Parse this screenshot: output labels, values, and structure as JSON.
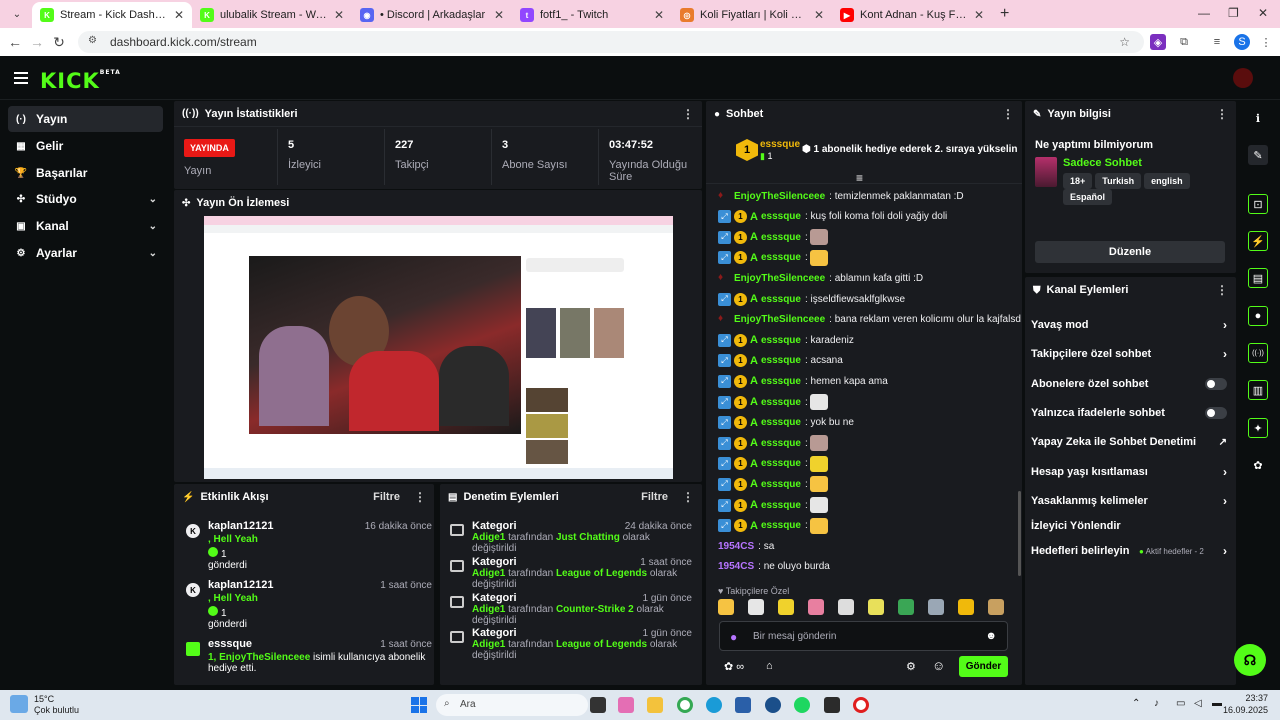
{
  "browser": {
    "tabs": [
      {
        "title": "Stream - Kick Dashboard",
        "fav": "K",
        "fav_color": "#53fc18",
        "active": true
      },
      {
        "title": "ulubalik Stream - Watch Live on",
        "fav": "K",
        "fav_color": "#53fc18"
      },
      {
        "title": "• Discord | Arkadaşlar",
        "fav": "◉",
        "fav_color": "#5865f2"
      },
      {
        "title": "fotf1_ - Twitch",
        "fav": "t",
        "fav_color": "#9146ff"
      },
      {
        "title": "Koli Fiyatları | Koli Karton ve Ambalaj",
        "fav": "◎",
        "fav_color": "#e97b2c"
      },
      {
        "title": "Kont Adnan - Kuş Foli. Official",
        "fav": "▶",
        "fav_color": "#ff0000"
      }
    ],
    "url": "dashboard.kick.com/stream"
  },
  "sidebar": {
    "items": [
      {
        "label": "Yayın",
        "icon": "broadcast-icon",
        "glyph": "(·)"
      },
      {
        "label": "Gelir",
        "icon": "revenue-icon",
        "glyph": "▦"
      },
      {
        "label": "Başarılar",
        "icon": "trophy-icon",
        "glyph": "🏆"
      },
      {
        "label": "Stüdyo",
        "icon": "studio-icon",
        "glyph": "✣"
      },
      {
        "label": "Kanal",
        "icon": "channel-icon",
        "glyph": "▣"
      },
      {
        "label": "Ayarlar",
        "icon": "settings-icon",
        "glyph": "⚙"
      }
    ]
  },
  "stats": {
    "title": "Yayın İstatistikleri",
    "live_badge": "YAYINDA",
    "live_label": "Yayın",
    "viewers": "5",
    "viewers_label": "İzleyici",
    "followers": "227",
    "followers_label": "Takipçi",
    "subs": "3",
    "subs_label": "Abone Sayısı",
    "uptime": "03:47:52",
    "uptime_label": "Yayında Olduğu Süre"
  },
  "preview": {
    "title": "Yayın Ön İzlemesi"
  },
  "activity": {
    "title": "Etkinlik Akışı",
    "filter": "Filtre",
    "items": [
      {
        "name": "kaplan12121",
        "time": "16 dakika önce",
        "msg": ", Hell Yeah",
        "count": "1",
        "sent": "gönderdi"
      },
      {
        "name": "kaplan12121",
        "time": "1 saat önce",
        "msg": ", Hell Yeah",
        "count": "1",
        "sent": "gönderdi"
      },
      {
        "name": "esssque",
        "time": "1 saat önce",
        "msg": "1, EnjoyTheSilenceee",
        "tail": " isimli kullanıcıya abonelik hediye etti."
      }
    ]
  },
  "moderation": {
    "title": "Denetim Eylemleri",
    "filter": "Filtre",
    "items": [
      {
        "t": "Kategori",
        "time": "24 dakika önce",
        "user": "Adige1",
        "mid": " tarafından ",
        "cat": "Just Chatting",
        "tail": " olarak değiştirildi"
      },
      {
        "t": "Kategori",
        "time": "1 saat önce",
        "user": "Adige1",
        "mid": " tarafından ",
        "cat": "League of Legends",
        "tail": " olarak değiştirildi"
      },
      {
        "t": "Kategori",
        "time": "1 gün önce",
        "user": "Adige1",
        "mid": " tarafından ",
        "cat": "Counter-Strike 2",
        "tail": " olarak değiştirildi"
      },
      {
        "t": "Kategori",
        "time": "1 gün önce",
        "user": "Adige1",
        "mid": " tarafından ",
        "cat": "League of Legends",
        "tail": " olarak değiştirildi"
      }
    ]
  },
  "chat": {
    "title": "Sohbet",
    "pinned_user": "esssque",
    "pinned_rank": "1",
    "pinned_count": "1",
    "pinned_text": "1 abonelik hediye ederek 2. sıraya yükselin",
    "messages": [
      {
        "user": "EnjoyTheSilenceee",
        "color": "#53fc18",
        "text": ": temizlenmek paklanmatan :D",
        "badges": "dot"
      },
      {
        "user": "esssque",
        "color": "#53fc18",
        "text": ": kuş foli koma foli doli yağiy doli",
        "badges": "full"
      },
      {
        "user": "esssque",
        "color": "#53fc18",
        "text": ":",
        "badges": "full",
        "emote": "#b89a94"
      },
      {
        "user": "esssque",
        "color": "#53fc18",
        "text": ":",
        "badges": "full",
        "emote": "#f6c342"
      },
      {
        "user": "EnjoyTheSilenceee",
        "color": "#53fc18",
        "text": ": ablamın kafa gitti :D",
        "badges": "dot"
      },
      {
        "user": "esssque",
        "color": "#53fc18",
        "text": ": işseldfiewsaklfglkwse",
        "badges": "full"
      },
      {
        "user": "EnjoyTheSilenceee",
        "color": "#53fc18",
        "text": ": bana reklam veren kolicımı olur la kajfalsd",
        "badges": "dot"
      },
      {
        "user": "esssque",
        "color": "#53fc18",
        "text": ": karadeniz",
        "badges": "full"
      },
      {
        "user": "esssque",
        "color": "#53fc18",
        "text": ": acsana",
        "badges": "full"
      },
      {
        "user": "esssque",
        "color": "#53fc18",
        "text": ": hemen kapa ama",
        "badges": "full"
      },
      {
        "user": "esssque",
        "color": "#53fc18",
        "text": ":",
        "badges": "full",
        "emote": "#e6e6e6"
      },
      {
        "user": "esssque",
        "color": "#53fc18",
        "text": ": yok bu ne",
        "badges": "full"
      },
      {
        "user": "esssque",
        "color": "#53fc18",
        "text": ":",
        "badges": "full",
        "emote": "#b89a94"
      },
      {
        "user": "esssque",
        "color": "#53fc18",
        "text": ":",
        "badges": "full",
        "emote": "#f0d22c"
      },
      {
        "user": "esssque",
        "color": "#53fc18",
        "text": ":",
        "badges": "full",
        "emote": "#f6c342"
      },
      {
        "user": "esssque",
        "color": "#53fc18",
        "text": ":",
        "badges": "full",
        "emote": "#e6e6e6"
      },
      {
        "user": "esssque",
        "color": "#53fc18",
        "text": ":",
        "badges": "full",
        "emote": "#f6c342"
      },
      {
        "user": "1954CS",
        "color": "#b675ff",
        "text": ": sa",
        "badges": "none"
      },
      {
        "user": "1954CS",
        "color": "#b675ff",
        "text": ": ne oluyo burda",
        "badges": "none"
      }
    ],
    "followers_only": "Takipçilere Özel",
    "placeholder": "Bir mesaj gönderin",
    "send": "Gönder"
  },
  "info": {
    "title": "Yayın bilgisi",
    "stream_title": "Ne yaptımı bilmiyorum",
    "category": "Sadece Sohbet",
    "tags": [
      "18+",
      "Turkish",
      "english",
      "Español"
    ],
    "edit": "Düzenle"
  },
  "actions": {
    "title": "Kanal Eylemleri",
    "items": [
      {
        "label": "Yavaş mod",
        "type": "arrow"
      },
      {
        "label": "Takipçilere özel sohbet",
        "type": "arrow"
      },
      {
        "label": "Abonelere özel sohbet",
        "type": "toggle"
      },
      {
        "label": "Yalnızca ifadelerle sohbet",
        "type": "toggle"
      },
      {
        "label": "Yapay Zeka ile Sohbet Denetimi",
        "type": "ext"
      },
      {
        "label": "Hesap yaşı kısıtlaması",
        "type": "arrow"
      },
      {
        "label": "Yasaklanmış kelimeler",
        "type": "arrow"
      },
      {
        "label": "İzleyici Yönlendir",
        "type": "none"
      },
      {
        "label": "Hedefleri belirleyin",
        "type": "arrow",
        "extra": "Aktif hedefler - 2"
      }
    ]
  },
  "taskbar": {
    "weather_temp": "15°C",
    "weather_desc": "Çok bulutlu",
    "search": "Ara",
    "time": "23:37",
    "date": "16.09.2025"
  }
}
